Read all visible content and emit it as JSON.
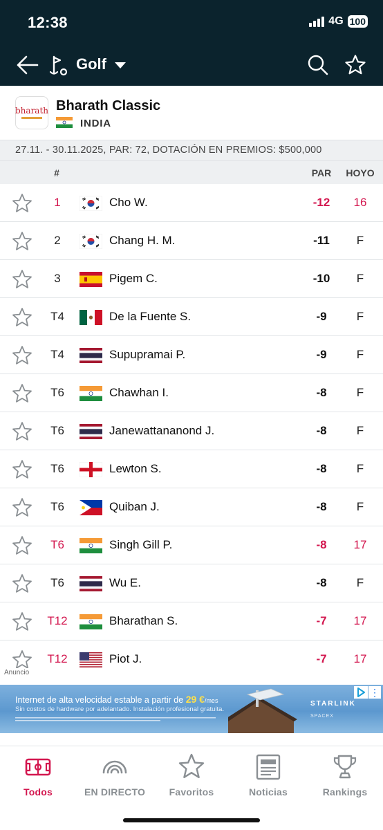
{
  "status_bar": {
    "time": "12:38",
    "network": "4G",
    "battery": "100"
  },
  "header": {
    "sport": "Golf"
  },
  "tournament": {
    "name": "Bharath Classic",
    "country": "INDIA",
    "logo_text": "bharath",
    "info": "27.11. - 30.11.2025, PAR: 72, DOTACIÓN EN PREMIOS: $500,000"
  },
  "columns": {
    "position": "#",
    "par": "PAR",
    "hole": "HOYO"
  },
  "players": [
    {
      "pos": "1",
      "name": "Cho W.",
      "par": "-12",
      "hole": "16",
      "flag": "korea",
      "live": true
    },
    {
      "pos": "2",
      "name": "Chang H. M.",
      "par": "-11",
      "hole": "F",
      "flag": "korea",
      "live": false
    },
    {
      "pos": "3",
      "name": "Pigem C.",
      "par": "-10",
      "hole": "F",
      "flag": "spain",
      "live": false
    },
    {
      "pos": "T4",
      "name": "De la Fuente S.",
      "par": "-9",
      "hole": "F",
      "flag": "mexico",
      "live": false
    },
    {
      "pos": "T4",
      "name": "Supupramai P.",
      "par": "-9",
      "hole": "F",
      "flag": "thailand",
      "live": false
    },
    {
      "pos": "T6",
      "name": "Chawhan I.",
      "par": "-8",
      "hole": "F",
      "flag": "india",
      "live": false
    },
    {
      "pos": "T6",
      "name": "Janewattananond J.",
      "par": "-8",
      "hole": "F",
      "flag": "thailand",
      "live": false
    },
    {
      "pos": "T6",
      "name": "Lewton S.",
      "par": "-8",
      "hole": "F",
      "flag": "england",
      "live": false
    },
    {
      "pos": "T6",
      "name": "Quiban J.",
      "par": "-8",
      "hole": "F",
      "flag": "philippines",
      "live": false
    },
    {
      "pos": "T6",
      "name": "Singh Gill P.",
      "par": "-8",
      "hole": "17",
      "flag": "india",
      "live": true
    },
    {
      "pos": "T6",
      "name": "Wu E.",
      "par": "-8",
      "hole": "F",
      "flag": "thailand",
      "live": false
    },
    {
      "pos": "T12",
      "name": "Bharathan S.",
      "par": "-7",
      "hole": "17",
      "flag": "india",
      "live": true
    },
    {
      "pos": "T12",
      "name": "Piot J.",
      "par": "-7",
      "hole": "17",
      "flag": "usa",
      "live": true
    }
  ],
  "ad": {
    "label": "Anuncio",
    "headline": "Internet de alta velocidad estable a partir de ",
    "price": "29 €",
    "per": "/mes",
    "sub": "Sin costos de hardware por adelantado. Instalación profesional gratuita.",
    "brand": "STARLINK",
    "brand_sub": "SPACEX"
  },
  "tabs": [
    {
      "label": "Todos",
      "icon": "field-icon",
      "active": true
    },
    {
      "label": "EN DIRECTO",
      "icon": "live-icon",
      "active": false
    },
    {
      "label": "Favoritos",
      "icon": "star-icon",
      "active": false
    },
    {
      "label": "Noticias",
      "icon": "news-icon",
      "active": false
    },
    {
      "label": "Rankings",
      "icon": "trophy-icon",
      "active": false
    }
  ],
  "colors": {
    "header_bg": "#0b232d",
    "accent": "#d3174f",
    "muted": "#8a8f93",
    "band": "#eef0f2"
  }
}
